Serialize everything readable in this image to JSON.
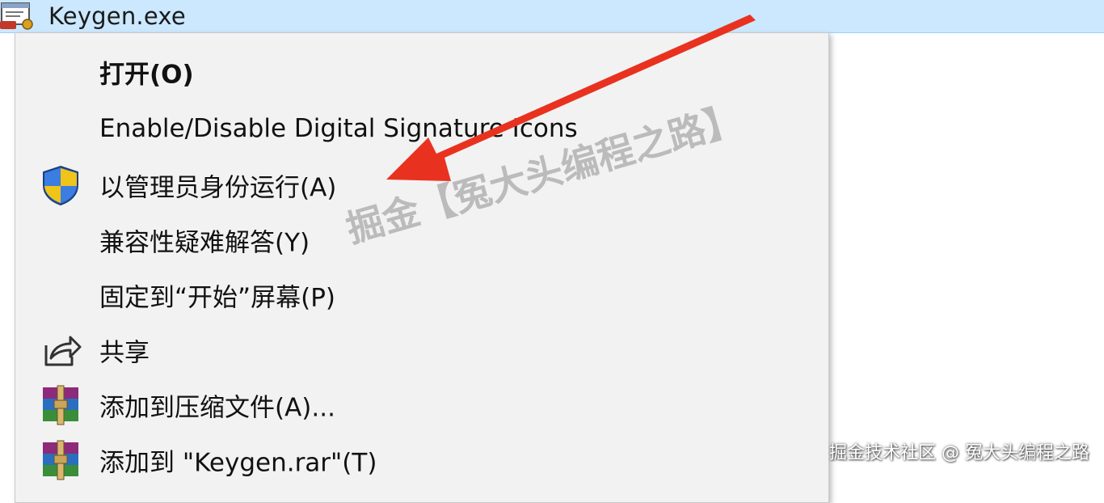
{
  "file": {
    "name": "Keygen.exe",
    "icon": "application-exe-icon"
  },
  "menu": {
    "items": [
      {
        "label": "打开(O)",
        "icon": null
      },
      {
        "label": "Enable/Disable Digital Signature Icons",
        "icon": null
      },
      {
        "label": "以管理员身份运行(A)",
        "icon": "uac-shield-icon"
      },
      {
        "label": "兼容性疑难解答(Y)",
        "icon": null
      },
      {
        "label": "固定到“开始”屏幕(P)",
        "icon": null
      },
      {
        "label": "共享",
        "icon": "share-icon"
      },
      {
        "label": "添加到压缩文件(A)...",
        "icon": "winrar-icon"
      },
      {
        "label": "添加到 \"Keygen.rar\"(T)",
        "icon": "winrar-icon"
      }
    ]
  },
  "annotation": {
    "arrow_color": "#e8321f"
  },
  "watermarks": {
    "center": "掘金【冤大头编程之路】",
    "corner": "掘金技术社区 @ 冤大头编程之路"
  },
  "colors": {
    "selection": "#cce8ff",
    "menu_bg": "#f2f2f2"
  }
}
